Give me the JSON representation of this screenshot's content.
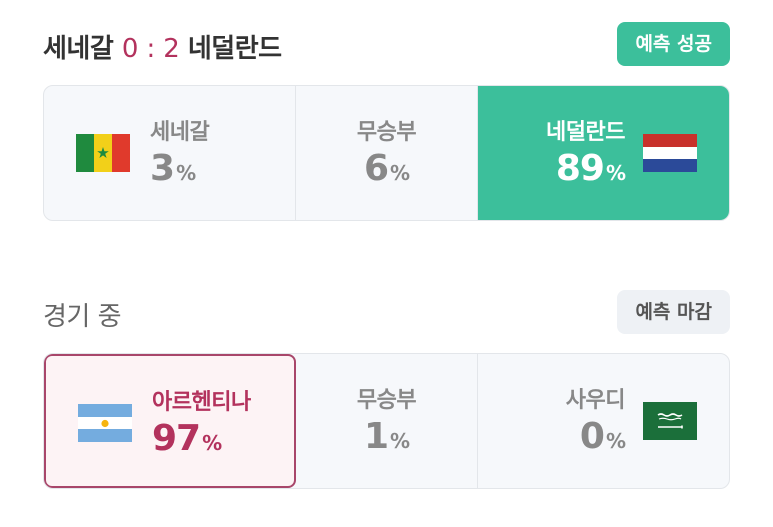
{
  "matches": [
    {
      "team_home": "세네갈",
      "score_home": "0",
      "score_sep": ":",
      "score_away": "2",
      "team_away": "네덜란드",
      "badge": "예측 성공",
      "options": [
        {
          "name": "세네갈",
          "percent": "3",
          "unit": "%",
          "flag": "senegal-flag"
        },
        {
          "name": "무승부",
          "percent": "6",
          "unit": "%"
        },
        {
          "name": "네덜란드",
          "percent": "89",
          "unit": "%",
          "flag": "netherlands-flag"
        }
      ]
    },
    {
      "status": "경기 중",
      "badge": "예측 마감",
      "options": [
        {
          "name": "아르헨티나",
          "percent": "97",
          "unit": "%",
          "flag": "argentina-flag"
        },
        {
          "name": "무승부",
          "percent": "1",
          "unit": "%"
        },
        {
          "name": "사우디",
          "percent": "0",
          "unit": "%",
          "flag": "saudi-arabia-flag"
        }
      ]
    }
  ],
  "colors": {
    "success": "#3cbf9b",
    "accent": "#b3325d",
    "closed_badge_bg": "#eef1f5"
  }
}
